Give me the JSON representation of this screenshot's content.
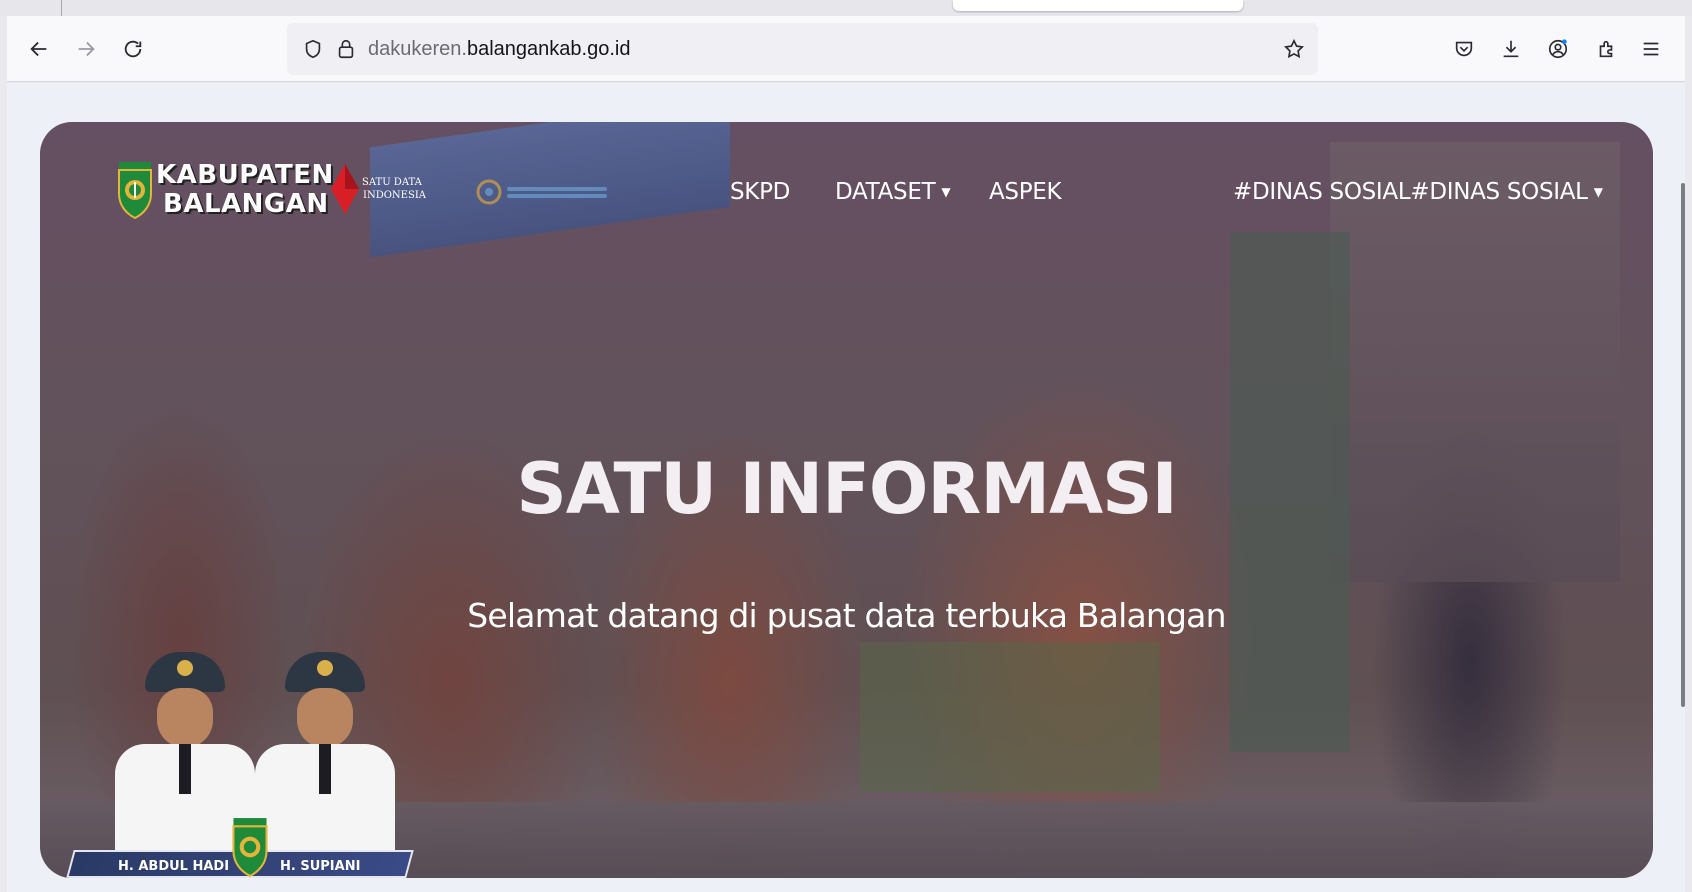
{
  "browser": {
    "url_subdomain": "dakukeren.",
    "url_domain": "balangankab.go.id",
    "icons": {
      "back": "back-arrow-icon",
      "forward": "forward-arrow-icon",
      "reload": "reload-icon",
      "tracking_protection": "shield-icon",
      "secure": "lock-icon",
      "bookmark": "star-icon",
      "pocket": "pocket-icon",
      "downloads": "download-icon",
      "account": "account-icon",
      "extensions": "extensions-icon",
      "menu": "hamburger-menu-icon"
    }
  },
  "site": {
    "logo_line1": "KABUPATEN",
    "logo_line2": "BALANGAN",
    "sdi_line1": "SATU DATA",
    "sdi_line2": "INDONESIA",
    "nav": {
      "skpd": "SKPD",
      "dataset": "DATASET",
      "aspek": "ASPEK",
      "user": "#DINAS SOSIAL#DINAS SOSIAL"
    },
    "hero_title": "SATU INFORMASI",
    "hero_subtitle": "Selamat datang di pusat data terbuka Balangan",
    "officials": {
      "left_name": "H. ABDUL HADI",
      "right_name": "H. SUPIANI"
    },
    "colors": {
      "sdi_red": "#d81f26",
      "crest_green": "#1f8a3a",
      "crest_gold": "#e3b53a"
    }
  }
}
